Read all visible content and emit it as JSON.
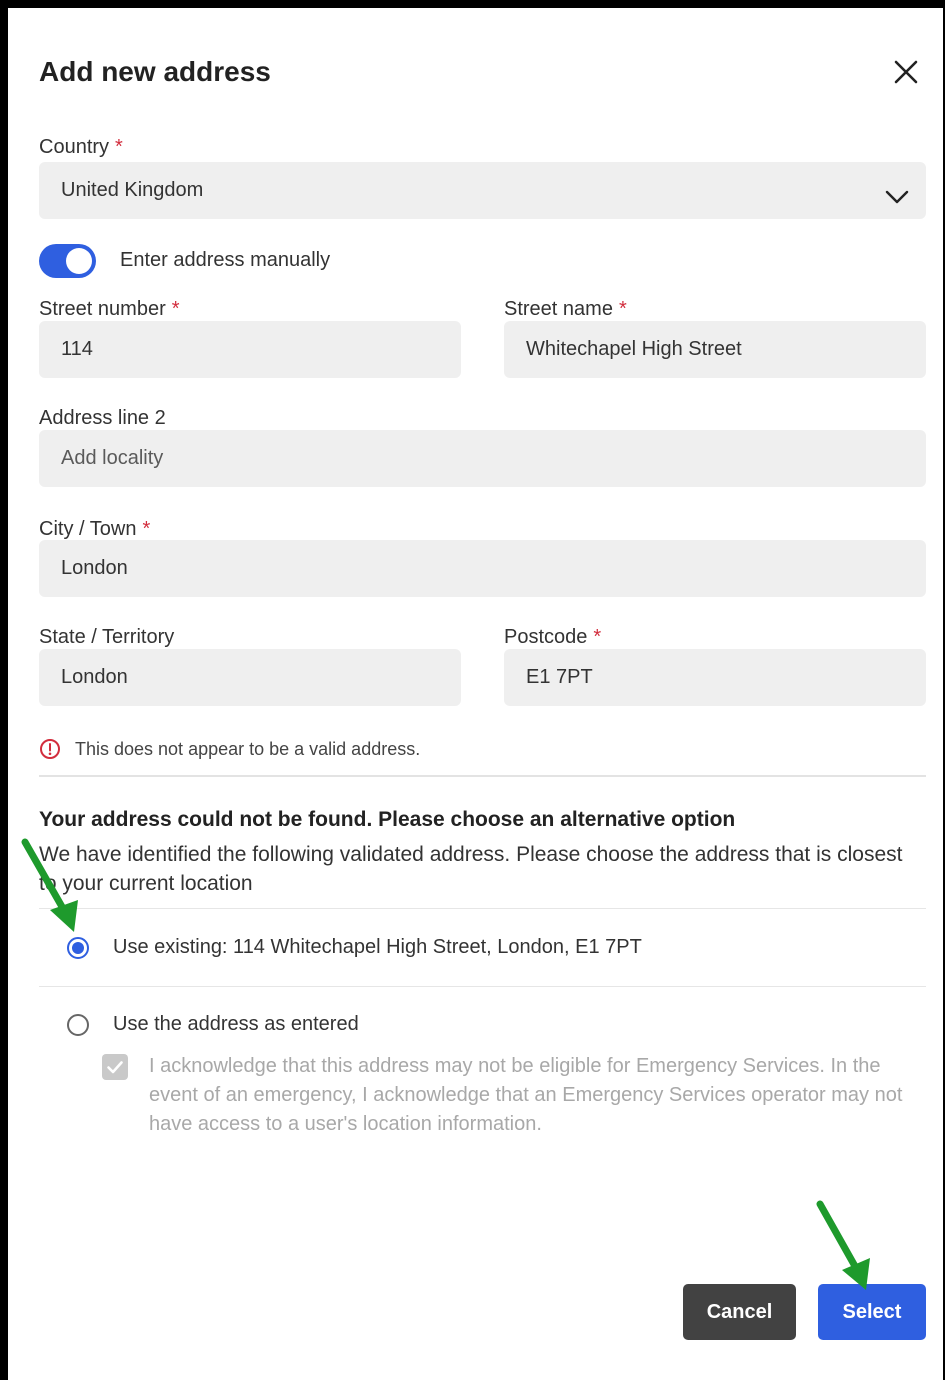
{
  "dialog": {
    "title": "Add new address"
  },
  "form": {
    "country_label": "Country",
    "country_value": "United Kingdom",
    "manual_toggle_label": "Enter address manually",
    "manual_toggle_on": true,
    "street_number_label": "Street number",
    "street_number_value": "114",
    "street_name_label": "Street name",
    "street_name_value": "Whitechapel High Street",
    "address2_label": "Address line 2",
    "address2_placeholder": "Add locality",
    "city_label": "City / Town",
    "city_value": "London",
    "state_label": "State / Territory",
    "state_value": "London",
    "postcode_label": "Postcode",
    "postcode_value": "E1 7PT",
    "required_marker": "*"
  },
  "validation": {
    "error_text": "This does not appear to be a valid address."
  },
  "alternatives": {
    "title": "Your address could not be found. Please choose an alternative option",
    "description": "We have identified the following validated address. Please choose the address that is closest to your current location",
    "option_existing": "Use existing: 114 Whitechapel High Street, London, E1 7PT",
    "option_entered": "Use the address as entered",
    "selected": "existing",
    "acknowledgement": "I acknowledge that this address may not be eligible for Emergency Services. In the event of an emergency, I acknowledge that an Emergency Services operator may not have access to a user's location information."
  },
  "actions": {
    "cancel_label": "Cancel",
    "select_label": "Select"
  },
  "colors": {
    "accent": "#2f5fe0",
    "required": "#d22d3d",
    "annotation_arrow": "#1e9a2c"
  },
  "icons": [
    "close-icon",
    "chevron-down-icon",
    "error-icon",
    "check-icon",
    "arrow-annotation"
  ]
}
